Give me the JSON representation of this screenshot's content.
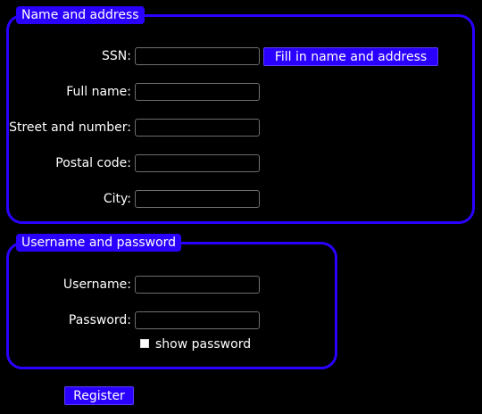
{
  "colors": {
    "accent": "#2a00ff",
    "background": "#000000",
    "text": "#ffffff",
    "input_border": "#6f6f6f"
  },
  "name_address": {
    "legend": "Name and address",
    "ssn_label": "SSN:",
    "ssn_value": "",
    "fill_button_label": "Fill in name and address",
    "full_name_label": "Full name:",
    "full_name_value": "",
    "street_label": "Street and number:",
    "street_value": "",
    "postal_label": "Postal code:",
    "postal_value": "",
    "city_label": "City:",
    "city_value": ""
  },
  "credentials": {
    "legend": "Username and password",
    "username_label": "Username:",
    "username_value": "",
    "password_label": "Password:",
    "password_value": "",
    "show_password_label": "show password",
    "show_password_checked": false
  },
  "register_button_label": "Register"
}
